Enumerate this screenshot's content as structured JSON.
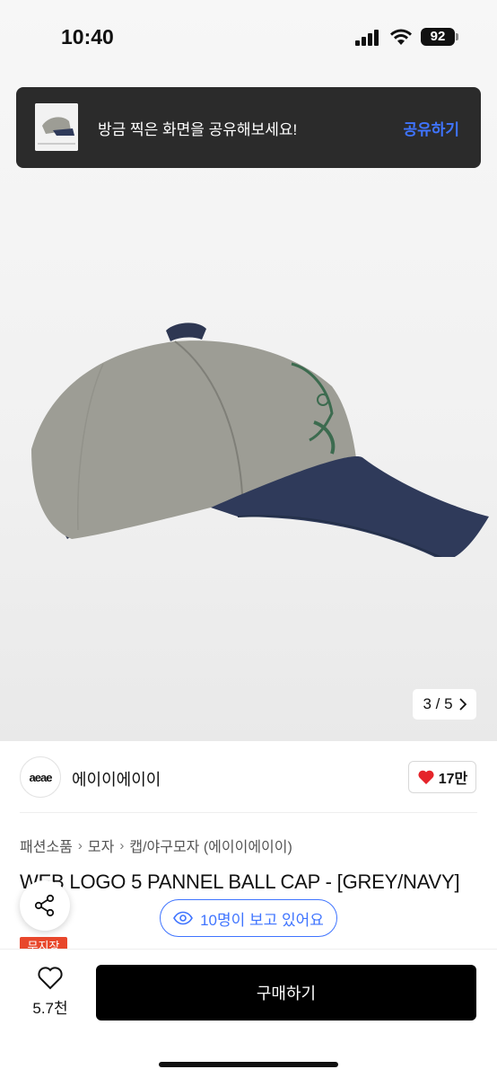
{
  "status_bar": {
    "time": "10:40",
    "battery": "92"
  },
  "toast": {
    "message": "방금 찍은 화면을 공유해보세요!",
    "action": "공유하기"
  },
  "gallery": {
    "counter": "3 / 5"
  },
  "brand": {
    "logo_text": "aeae",
    "name": "에이이에이이",
    "likes": "17만"
  },
  "breadcrumb": [
    "패션소품",
    "모자",
    "캡/야구모자 (에이이에이이)"
  ],
  "product": {
    "title": "WEB LOGO 5 PANNEL BALL CAP - [GREY/NAVY]",
    "tag": "무지장"
  },
  "viewers": {
    "text": "10명이 보고 있어요"
  },
  "bottom_bar": {
    "wish_count": "5.7천",
    "buy_label": "구매하기"
  },
  "colors": {
    "accent": "#3f74ff",
    "heart": "#e5242a",
    "tag": "#e8472b",
    "buy": "#000000"
  }
}
